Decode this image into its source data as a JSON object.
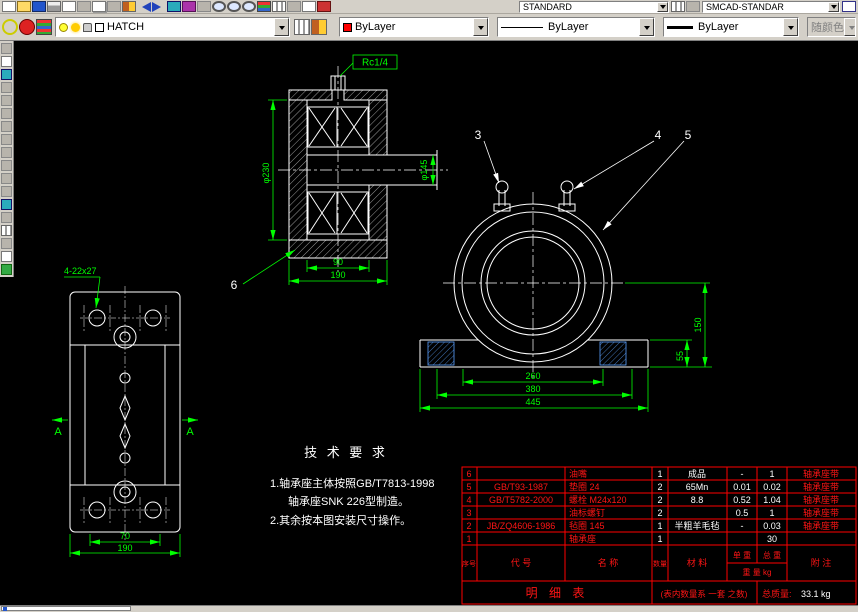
{
  "colors": {
    "background": "#000000",
    "geometry": "#ffffff",
    "dimensions": "#00ff00",
    "table": "#ff0000",
    "hatch_blue": "#5aa0ff",
    "toolbar": "#d4d0c8"
  },
  "toolbars": {
    "row1": {
      "icons_left": [
        {
          "name": "new",
          "style": "s-doc"
        },
        {
          "name": "open",
          "style": "s-folder"
        },
        {
          "name": "save",
          "style": "s-save"
        },
        {
          "name": "plot",
          "style": "s-print"
        },
        {
          "name": "plot-preview",
          "style": "s-doc"
        },
        {
          "name": "cut",
          "style": "s-gray"
        },
        {
          "name": "copy",
          "style": "s-copy"
        },
        {
          "name": "paste",
          "style": "s-gray"
        },
        {
          "name": "match-properties",
          "style": "s-brush"
        },
        {
          "name": "undo",
          "style": "s-arrl"
        },
        {
          "name": "redo",
          "style": "s-arrr"
        },
        {
          "name": "insert-block",
          "style": "s-cyan"
        },
        {
          "name": "object-snap",
          "style": "s-magenta"
        },
        {
          "name": "pan",
          "style": "s-gray"
        },
        {
          "name": "zoom-realtime",
          "style": "s-zoom"
        },
        {
          "name": "zoom-window",
          "style": "s-zoom"
        },
        {
          "name": "zoom-previous",
          "style": "s-zoom"
        },
        {
          "name": "layers",
          "style": "s-layers"
        },
        {
          "name": "properties",
          "style": "s-grid"
        },
        {
          "name": "distance",
          "style": "s-gray"
        },
        {
          "name": "script",
          "style": "s-doc"
        },
        {
          "name": "toolbox",
          "style": "s-red"
        }
      ],
      "standard_combo": "STANDARD",
      "icons_mid": [
        {
          "name": "style-manager",
          "style": "s-grid"
        },
        {
          "name": "settings",
          "style": "s-gray"
        }
      ],
      "smcad_combo": "SMCAD-STANDAR",
      "icons_right": [
        {
          "name": "help",
          "style": "s-help"
        }
      ]
    },
    "row2": {
      "icons_left": [
        {
          "name": "color-ring",
          "style": "s-ring"
        },
        {
          "name": "drawing-ball",
          "style": "s-ball"
        },
        {
          "name": "layer-manager",
          "style": "s-layers"
        }
      ],
      "layer_minis": [
        {
          "name": "layer-on-bulb",
          "style": "s-bulb"
        },
        {
          "name": "layer-freeze-sun",
          "style": "s-sun"
        },
        {
          "name": "layer-lock",
          "style": "s-lock"
        },
        {
          "name": "layer-color-swatch",
          "style": "s-swatch"
        }
      ],
      "layer_value": "HATCH",
      "icons_mid": [
        {
          "name": "layer-states",
          "style": "s-grid"
        },
        {
          "name": "make-object-layer",
          "style": "s-brush"
        }
      ],
      "color_value": "ByLayer",
      "linetype_value": "ByLayer",
      "lineweight_value": "ByLayer",
      "plotstyle_value": "随颜色"
    },
    "left": {
      "icons": [
        {
          "name": "select",
          "style": "s-gray"
        },
        {
          "name": "quick-select",
          "style": "s-doc"
        },
        {
          "name": "line",
          "style": "s-cyan"
        },
        {
          "name": "construction-line",
          "style": "s-gray"
        },
        {
          "name": "polyline",
          "style": "s-gray"
        },
        {
          "name": "polygon",
          "style": "s-gray"
        },
        {
          "name": "rectangle",
          "style": "s-gray"
        },
        {
          "name": "arc",
          "style": "s-gray"
        },
        {
          "name": "circle",
          "style": "s-gray"
        },
        {
          "name": "revision-cloud",
          "style": "s-gray"
        },
        {
          "name": "spline",
          "style": "s-gray"
        },
        {
          "name": "ellipse",
          "style": "s-gray"
        },
        {
          "name": "block",
          "style": "s-cyan"
        },
        {
          "name": "point",
          "style": "s-gray"
        },
        {
          "name": "hatch",
          "style": "s-grid"
        },
        {
          "name": "region",
          "style": "s-gray"
        },
        {
          "name": "mtext",
          "style": "s-doc"
        },
        {
          "name": "dimension",
          "style": "s-green"
        }
      ]
    }
  },
  "drawing": {
    "section": {
      "fitting_label": "Rc1/4",
      "dim_bore": "φ230",
      "dim_shaft": "φ145",
      "dim_inner": "90",
      "dim_outer": "190",
      "callout": "6"
    },
    "plan": {
      "holes_label": "4-22x27",
      "section_letter": "A",
      "dim_inner": "70",
      "dim_outer": "190"
    },
    "front": {
      "callout_3": "3",
      "callout_4": "4",
      "callout_5": "5",
      "dim_center_height": "150",
      "dim_base_height": "55",
      "dim_span_inner": "260",
      "dim_span_mid": "380",
      "dim_span_outer": "445"
    },
    "tech": {
      "title": "技 术 要 求",
      "line1": "1.轴承座主体按照GB/T7813-1998",
      "line2": "轴承座SNK 226型制造。",
      "line3": "2.其余按本图安装尺寸操作。"
    },
    "bom": {
      "rows": [
        {
          "no": "6",
          "code": "",
          "name": "油嘴",
          "qty": "1",
          "material": "成品",
          "unit": "-",
          "total": "1",
          "note": "轴承座带"
        },
        {
          "no": "5",
          "code": "GB/T93-1987",
          "name": "垫圈 24",
          "qty": "2",
          "material": "65Mn",
          "unit": "0.01",
          "total": "0.02",
          "note": "轴承座带"
        },
        {
          "no": "4",
          "code": "GB/T5782-2000",
          "name": "螺栓 M24x120",
          "qty": "2",
          "material": "8.8",
          "unit": "0.52",
          "total": "1.04",
          "note": "轴承座带"
        },
        {
          "no": "3",
          "code": "",
          "name": "油标螺钉",
          "qty": "2",
          "material": "",
          "unit": "0.5",
          "total": "1",
          "note": "轴承座带"
        },
        {
          "no": "2",
          "code": "JB/ZQ4606-1986",
          "name": "毡圈 145",
          "qty": "1",
          "material": "半粗羊毛毡",
          "unit": "-",
          "total": "0.03",
          "note": "轴承座带"
        },
        {
          "no": "1",
          "code": "",
          "name": "轴承座",
          "qty": "1",
          "material": "",
          "unit": "",
          "total": "30",
          "note": ""
        }
      ],
      "headers": {
        "no": "序号",
        "code": "代  号",
        "name": "名  称",
        "qty": "数量",
        "material": "材  料",
        "unit": "单 重",
        "total": "总 重",
        "weight": "重 量 kg",
        "note": "附 注"
      },
      "footer": {
        "title": "明 细 表",
        "note": "(表内数量系 一套 之数)",
        "mass_label": "总质量:",
        "mass_value": "33.1  kg"
      }
    }
  }
}
